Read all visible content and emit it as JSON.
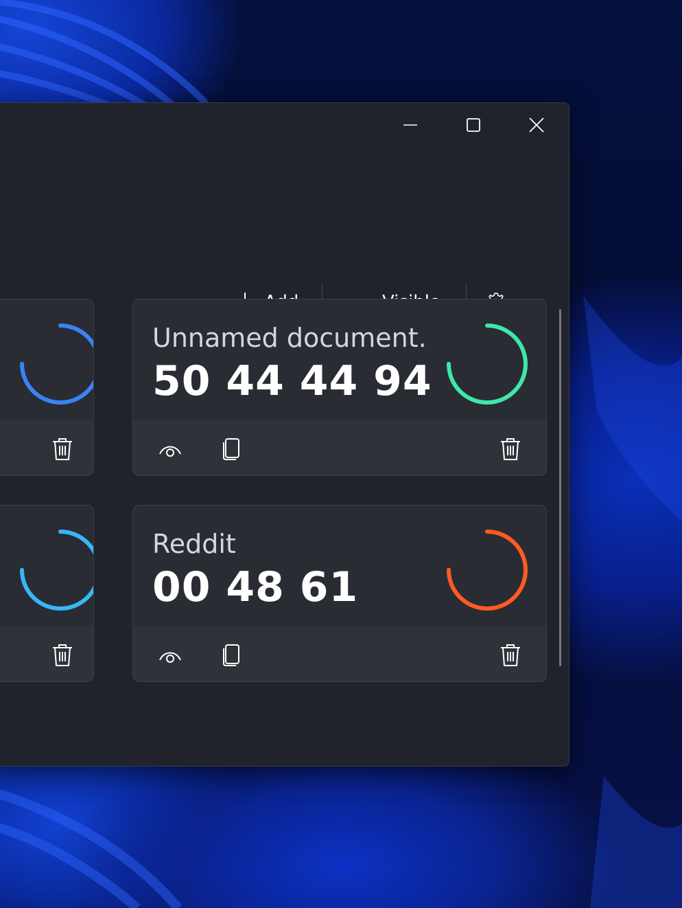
{
  "toolbar": {
    "add_label": "Add",
    "visible_label": "Visible"
  },
  "cards": [
    {
      "title": "",
      "code": "",
      "ring_color": "#3b82f6",
      "ring_progress": 0.75
    },
    {
      "title": "Unnamed document...",
      "code": "50 44 44 94",
      "ring_color": "#3ee8a8",
      "ring_progress": 0.75
    },
    {
      "title": "",
      "code": "",
      "ring_color": "#38b6f5",
      "ring_progress": 0.75
    },
    {
      "title": "Reddit",
      "code": "00 48 61",
      "ring_color": "#ff5a23",
      "ring_progress": 0.75
    }
  ],
  "colors": {
    "window_bg": "#20232b",
    "card_bg": "#292c33",
    "card_footer_bg": "#2f3239"
  },
  "icons": [
    "minimize-icon",
    "maximize-icon",
    "close-icon",
    "plus-icon",
    "eye-icon",
    "gear-icon",
    "copy-icon",
    "trash-icon"
  ]
}
